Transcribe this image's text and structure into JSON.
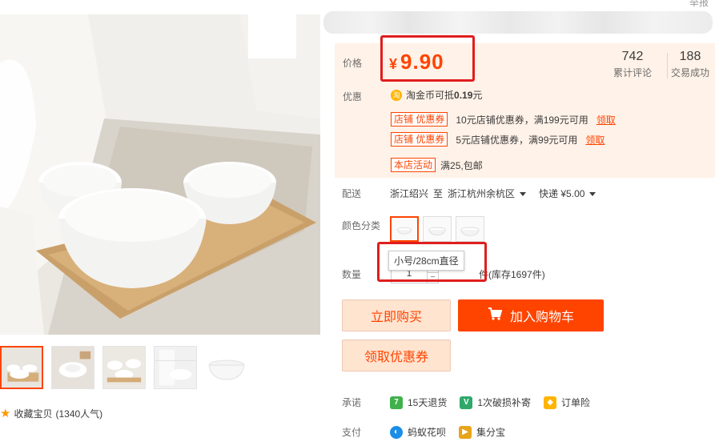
{
  "header": {
    "report_label": "举报"
  },
  "gallery": {
    "favorite_label": "收藏宝贝",
    "favorite_count": "(1340人气)"
  },
  "price": {
    "label": "价格",
    "currency": "¥",
    "value": "9.90",
    "stats": [
      {
        "number": "742",
        "label": "累计评论"
      },
      {
        "number": "188",
        "label": "交易成功"
      }
    ]
  },
  "promo": {
    "label": "优惠",
    "coin_icon": "淘",
    "coin_text_prefix": "淘金币可抵",
    "coin_amount": "0.19",
    "coin_unit": "元",
    "coupons": [
      {
        "tag": "店铺 优惠券",
        "text": "10元店铺优惠券，满199元可用",
        "action": "领取"
      },
      {
        "tag": "店铺 优惠券",
        "text": "5元店铺优惠券，满99元可用",
        "action": "领取"
      }
    ],
    "activity": {
      "tag": "本店活动",
      "text": "满25,包邮"
    }
  },
  "delivery": {
    "label": "配送",
    "from": "浙江绍兴",
    "to_word": "至",
    "to": "浙江杭州余杭区",
    "method": "快递 ¥5.00"
  },
  "colors": {
    "label": "颜色分类",
    "selected_index": 0,
    "tooltip": "小号/28cm直径"
  },
  "quantity": {
    "label": "数量",
    "value": "1",
    "stock": "件(库存1697件)"
  },
  "actions": {
    "buy_now": "立即购买",
    "add_to_cart": "加入购物车",
    "get_coupon": "领取优惠券"
  },
  "promise": {
    "label": "承诺",
    "items": [
      {
        "icon": "7",
        "icon_color": "#3fb14b",
        "text": "15天退货"
      },
      {
        "icon": "V",
        "icon_color": "#2fa86a",
        "text": "1次破损补寄"
      },
      {
        "icon": "◆",
        "icon_color": "#ffb400",
        "text": "订单险"
      }
    ]
  },
  "payment": {
    "label": "支付",
    "items": [
      {
        "icon": "◐",
        "icon_color": "#1a8ee8",
        "text": "蚂蚁花呗"
      },
      {
        "icon": "▶",
        "icon_color": "#e8a41a",
        "text": "集分宝"
      }
    ]
  },
  "colors_theme": {
    "accent": "#ff4400",
    "highlight_frame": "#e01e1e",
    "price_bg": "#fff2e8"
  }
}
